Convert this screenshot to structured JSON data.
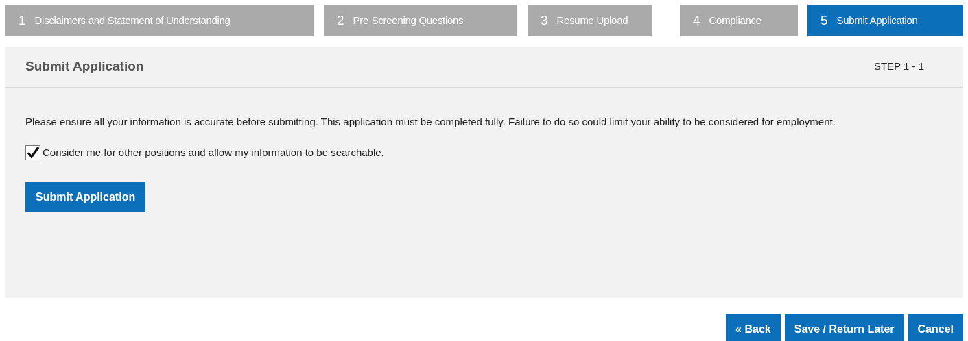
{
  "steps": [
    {
      "number": "1",
      "label": "Disclaimers and Statement of Understanding",
      "selected": false
    },
    {
      "number": "2",
      "label": "Pre-Screening Questions",
      "selected": false
    },
    {
      "number": "3",
      "label": "Resume Upload",
      "selected": false
    },
    {
      "number": "4",
      "label": "Compliance",
      "selected": false
    },
    {
      "number": "5",
      "label": "Submit Application",
      "selected": true
    }
  ],
  "panel": {
    "title": "Submit Application",
    "step_indicator": "STEP 1 - 1",
    "message": "Please ensure all your information is accurate before submitting.  This application must be completed fully.  Failure to do so could limit your ability to be considered for employment.",
    "checkbox": {
      "label": "Consider me for other positions and allow my information to be searchable.",
      "checked": true
    },
    "submit_button": "Submit Application"
  },
  "footer_buttons": [
    "« Back",
    "Save / Return Later",
    "Cancel"
  ]
}
